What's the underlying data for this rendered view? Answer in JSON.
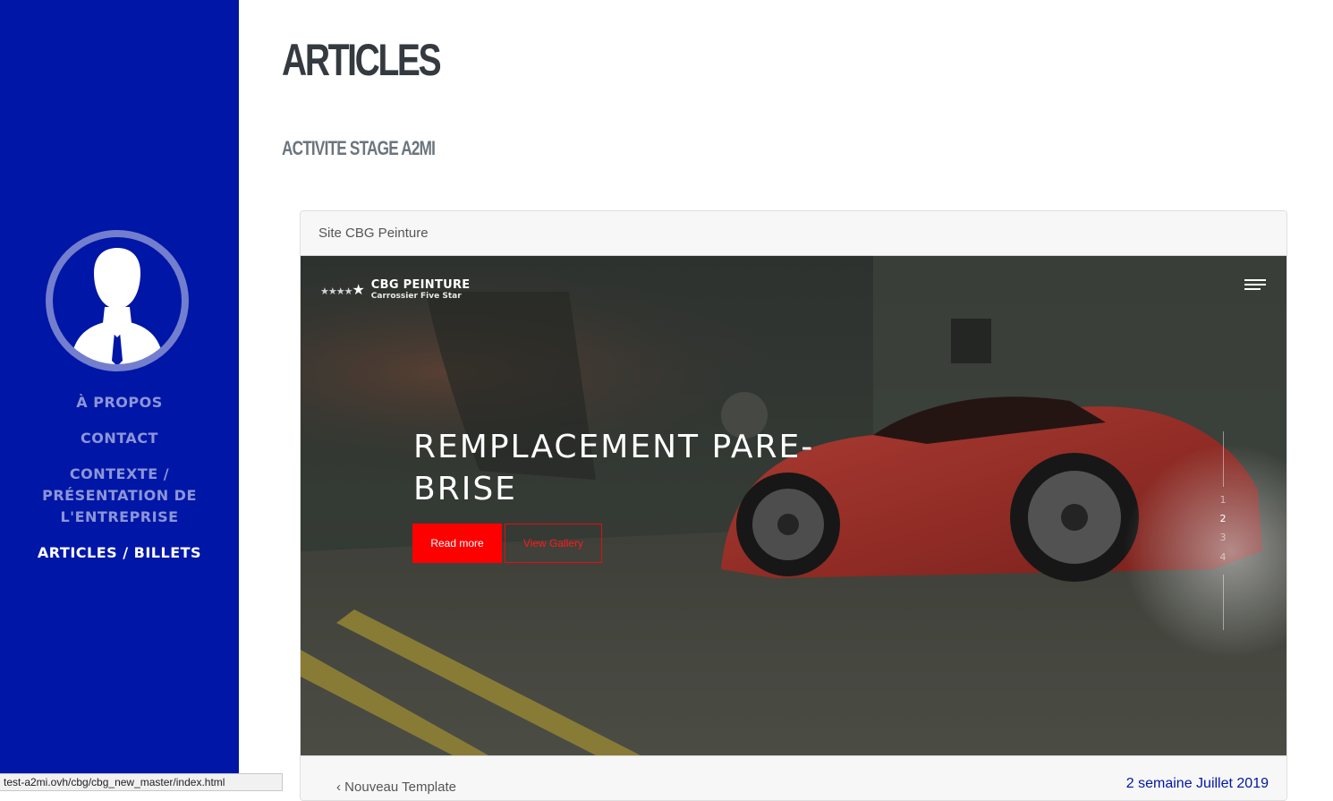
{
  "sidebar": {
    "nav": [
      {
        "label": "À propos"
      },
      {
        "label": "Contact"
      },
      {
        "label": "Contexte / Présentation de l'entreprise"
      },
      {
        "label": "Articles / Billets",
        "active": true
      }
    ],
    "background": "#0016a6"
  },
  "main": {
    "title": "Articles",
    "subtitle": "Activite Stage A2MI",
    "card": {
      "header": "Site CBG Peinture",
      "preview": {
        "logo_name": "CBG PEINTURE",
        "logo_tagline": "Carrossier Five Star",
        "logo_stars": "★★★★",
        "logo_star_big": "★",
        "hero_title": "REMPLACEMENT PARE-BRISE",
        "read_more": "Read more",
        "view_gallery": "View Gallery",
        "slides": [
          "1",
          "2",
          "3",
          "4"
        ],
        "active_slide": "2",
        "accent": "#ff0000"
      },
      "footer_left": "Nouveau Template",
      "footer_right": "2 semaine Juillet 2019"
    }
  },
  "statusbar": {
    "url": "test-a2mi.ovh/cbg/cbg_new_master/index.html"
  }
}
